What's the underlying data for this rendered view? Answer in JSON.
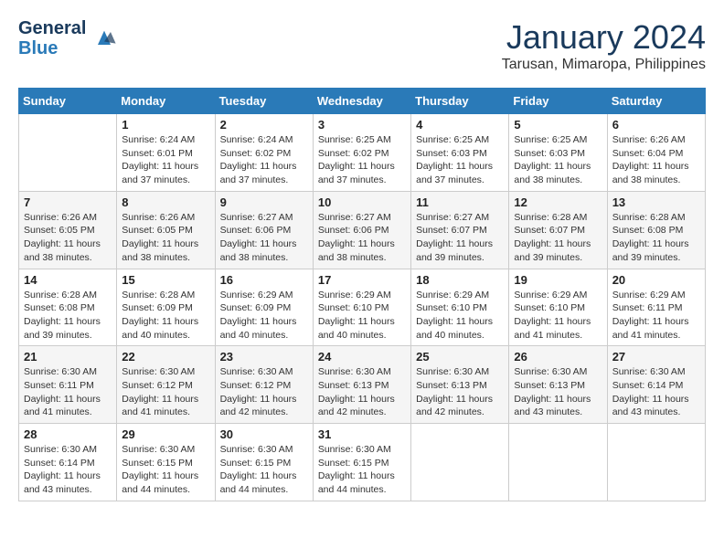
{
  "header": {
    "logo_line1": "General",
    "logo_line2": "Blue",
    "month": "January 2024",
    "location": "Tarusan, Mimaropa, Philippines"
  },
  "days_of_week": [
    "Sunday",
    "Monday",
    "Tuesday",
    "Wednesday",
    "Thursday",
    "Friday",
    "Saturday"
  ],
  "weeks": [
    [
      {
        "num": "",
        "sunrise": "",
        "sunset": "",
        "daylight": ""
      },
      {
        "num": "1",
        "sunrise": "Sunrise: 6:24 AM",
        "sunset": "Sunset: 6:01 PM",
        "daylight": "Daylight: 11 hours and 37 minutes."
      },
      {
        "num": "2",
        "sunrise": "Sunrise: 6:24 AM",
        "sunset": "Sunset: 6:02 PM",
        "daylight": "Daylight: 11 hours and 37 minutes."
      },
      {
        "num": "3",
        "sunrise": "Sunrise: 6:25 AM",
        "sunset": "Sunset: 6:02 PM",
        "daylight": "Daylight: 11 hours and 37 minutes."
      },
      {
        "num": "4",
        "sunrise": "Sunrise: 6:25 AM",
        "sunset": "Sunset: 6:03 PM",
        "daylight": "Daylight: 11 hours and 37 minutes."
      },
      {
        "num": "5",
        "sunrise": "Sunrise: 6:25 AM",
        "sunset": "Sunset: 6:03 PM",
        "daylight": "Daylight: 11 hours and 38 minutes."
      },
      {
        "num": "6",
        "sunrise": "Sunrise: 6:26 AM",
        "sunset": "Sunset: 6:04 PM",
        "daylight": "Daylight: 11 hours and 38 minutes."
      }
    ],
    [
      {
        "num": "7",
        "sunrise": "Sunrise: 6:26 AM",
        "sunset": "Sunset: 6:05 PM",
        "daylight": "Daylight: 11 hours and 38 minutes."
      },
      {
        "num": "8",
        "sunrise": "Sunrise: 6:26 AM",
        "sunset": "Sunset: 6:05 PM",
        "daylight": "Daylight: 11 hours and 38 minutes."
      },
      {
        "num": "9",
        "sunrise": "Sunrise: 6:27 AM",
        "sunset": "Sunset: 6:06 PM",
        "daylight": "Daylight: 11 hours and 38 minutes."
      },
      {
        "num": "10",
        "sunrise": "Sunrise: 6:27 AM",
        "sunset": "Sunset: 6:06 PM",
        "daylight": "Daylight: 11 hours and 38 minutes."
      },
      {
        "num": "11",
        "sunrise": "Sunrise: 6:27 AM",
        "sunset": "Sunset: 6:07 PM",
        "daylight": "Daylight: 11 hours and 39 minutes."
      },
      {
        "num": "12",
        "sunrise": "Sunrise: 6:28 AM",
        "sunset": "Sunset: 6:07 PM",
        "daylight": "Daylight: 11 hours and 39 minutes."
      },
      {
        "num": "13",
        "sunrise": "Sunrise: 6:28 AM",
        "sunset": "Sunset: 6:08 PM",
        "daylight": "Daylight: 11 hours and 39 minutes."
      }
    ],
    [
      {
        "num": "14",
        "sunrise": "Sunrise: 6:28 AM",
        "sunset": "Sunset: 6:08 PM",
        "daylight": "Daylight: 11 hours and 39 minutes."
      },
      {
        "num": "15",
        "sunrise": "Sunrise: 6:28 AM",
        "sunset": "Sunset: 6:09 PM",
        "daylight": "Daylight: 11 hours and 40 minutes."
      },
      {
        "num": "16",
        "sunrise": "Sunrise: 6:29 AM",
        "sunset": "Sunset: 6:09 PM",
        "daylight": "Daylight: 11 hours and 40 minutes."
      },
      {
        "num": "17",
        "sunrise": "Sunrise: 6:29 AM",
        "sunset": "Sunset: 6:10 PM",
        "daylight": "Daylight: 11 hours and 40 minutes."
      },
      {
        "num": "18",
        "sunrise": "Sunrise: 6:29 AM",
        "sunset": "Sunset: 6:10 PM",
        "daylight": "Daylight: 11 hours and 40 minutes."
      },
      {
        "num": "19",
        "sunrise": "Sunrise: 6:29 AM",
        "sunset": "Sunset: 6:10 PM",
        "daylight": "Daylight: 11 hours and 41 minutes."
      },
      {
        "num": "20",
        "sunrise": "Sunrise: 6:29 AM",
        "sunset": "Sunset: 6:11 PM",
        "daylight": "Daylight: 11 hours and 41 minutes."
      }
    ],
    [
      {
        "num": "21",
        "sunrise": "Sunrise: 6:30 AM",
        "sunset": "Sunset: 6:11 PM",
        "daylight": "Daylight: 11 hours and 41 minutes."
      },
      {
        "num": "22",
        "sunrise": "Sunrise: 6:30 AM",
        "sunset": "Sunset: 6:12 PM",
        "daylight": "Daylight: 11 hours and 41 minutes."
      },
      {
        "num": "23",
        "sunrise": "Sunrise: 6:30 AM",
        "sunset": "Sunset: 6:12 PM",
        "daylight": "Daylight: 11 hours and 42 minutes."
      },
      {
        "num": "24",
        "sunrise": "Sunrise: 6:30 AM",
        "sunset": "Sunset: 6:13 PM",
        "daylight": "Daylight: 11 hours and 42 minutes."
      },
      {
        "num": "25",
        "sunrise": "Sunrise: 6:30 AM",
        "sunset": "Sunset: 6:13 PM",
        "daylight": "Daylight: 11 hours and 42 minutes."
      },
      {
        "num": "26",
        "sunrise": "Sunrise: 6:30 AM",
        "sunset": "Sunset: 6:13 PM",
        "daylight": "Daylight: 11 hours and 43 minutes."
      },
      {
        "num": "27",
        "sunrise": "Sunrise: 6:30 AM",
        "sunset": "Sunset: 6:14 PM",
        "daylight": "Daylight: 11 hours and 43 minutes."
      }
    ],
    [
      {
        "num": "28",
        "sunrise": "Sunrise: 6:30 AM",
        "sunset": "Sunset: 6:14 PM",
        "daylight": "Daylight: 11 hours and 43 minutes."
      },
      {
        "num": "29",
        "sunrise": "Sunrise: 6:30 AM",
        "sunset": "Sunset: 6:15 PM",
        "daylight": "Daylight: 11 hours and 44 minutes."
      },
      {
        "num": "30",
        "sunrise": "Sunrise: 6:30 AM",
        "sunset": "Sunset: 6:15 PM",
        "daylight": "Daylight: 11 hours and 44 minutes."
      },
      {
        "num": "31",
        "sunrise": "Sunrise: 6:30 AM",
        "sunset": "Sunset: 6:15 PM",
        "daylight": "Daylight: 11 hours and 44 minutes."
      },
      {
        "num": "",
        "sunrise": "",
        "sunset": "",
        "daylight": ""
      },
      {
        "num": "",
        "sunrise": "",
        "sunset": "",
        "daylight": ""
      },
      {
        "num": "",
        "sunrise": "",
        "sunset": "",
        "daylight": ""
      }
    ]
  ]
}
